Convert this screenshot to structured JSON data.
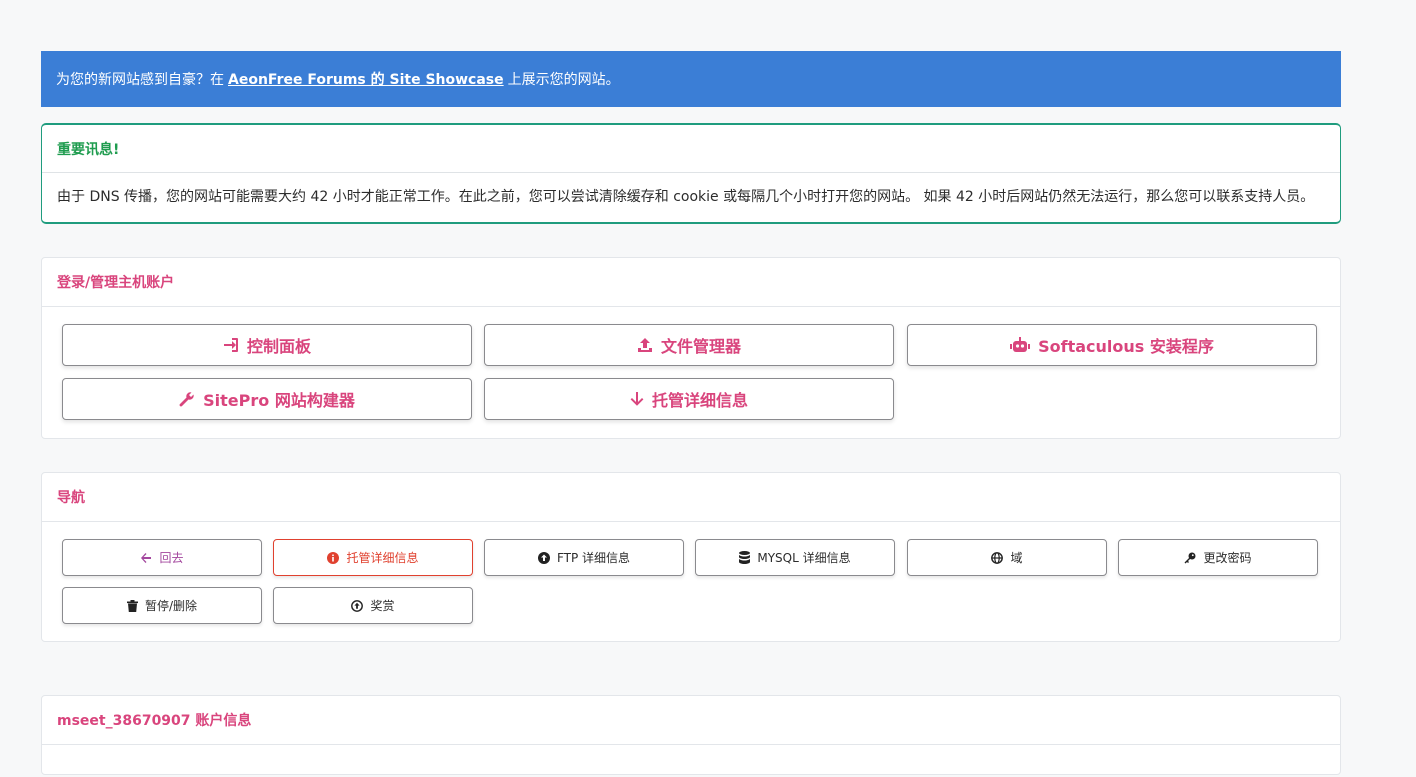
{
  "promo": {
    "prefix": "为您的新网站感到自豪？在",
    "link_text": "AeonFree Forums 的 Site Showcase",
    "suffix": "上展示您的网站。"
  },
  "notice": {
    "title": "重要讯息!",
    "body": "由于 DNS 传播，您的网站可能需要大约 42 小时才能正常工作。在此之前，您可以尝试清除缓存和 cookie 或每隔几个小时打开您的网站。 如果 42 小时后网站仍然无法运行，那么您可以联系支持人员。"
  },
  "login_card": {
    "title": "登录/管理主机账户",
    "buttons": [
      {
        "label": "控制面板",
        "icon": "sign-in-icon"
      },
      {
        "label": "文件管理器",
        "icon": "upload-icon"
      },
      {
        "label": "Softaculous 安装程序",
        "icon": "robot-icon"
      },
      {
        "label": "SitePro 网站构建器",
        "icon": "wrench-icon"
      },
      {
        "label": "托管详细信息",
        "icon": "arrow-down-icon"
      }
    ]
  },
  "nav_card": {
    "title": "导航",
    "buttons": [
      {
        "label": "回去",
        "icon": "arrow-left-icon"
      },
      {
        "label": "托管详细信息",
        "icon": "info-icon"
      },
      {
        "label": "FTP 详细信息",
        "icon": "arrow-up-circle-icon"
      },
      {
        "label": "MYSQL 详细信息",
        "icon": "database-icon"
      },
      {
        "label": "域",
        "icon": "globe-icon"
      },
      {
        "label": "更改密码",
        "icon": "key-icon"
      },
      {
        "label": "暂停/删除",
        "icon": "trash-icon"
      },
      {
        "label": "奖赏",
        "icon": "arrow-up-circle-outline-icon"
      }
    ]
  },
  "account_card": {
    "title": "mseet_38670907 账户信息"
  },
  "colors": {
    "promo_bg": "#3b7ed6",
    "accent_pink": "#d9457d",
    "notice_green": "#1f9c4f",
    "active_red": "#e0412f"
  }
}
